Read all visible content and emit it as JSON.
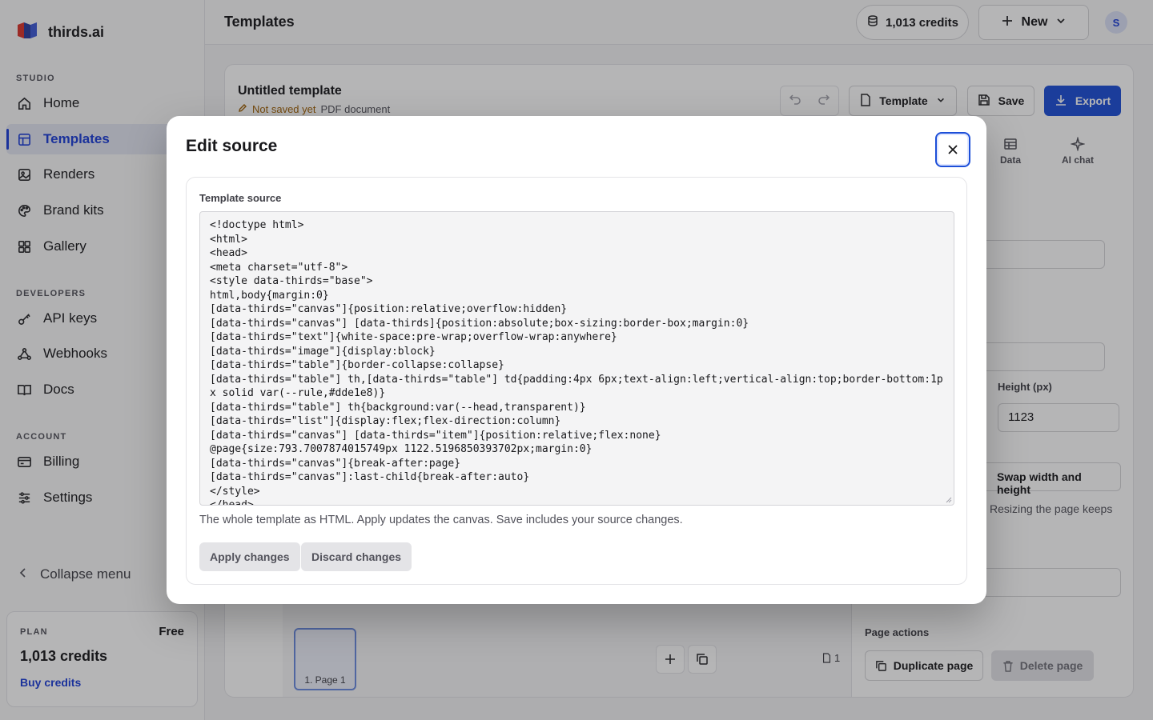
{
  "brand": {
    "name": "thirds.ai"
  },
  "sidebar": {
    "sections": {
      "studio": "STUDIO",
      "developers": "DEVELOPERS",
      "account": "ACCOUNT"
    },
    "items": [
      {
        "label": "Home",
        "icon": "home-icon"
      },
      {
        "label": "Templates",
        "icon": "templates-icon",
        "active": true
      },
      {
        "label": "Renders",
        "icon": "image-icon"
      },
      {
        "label": "Brand kits",
        "icon": "palette-icon"
      },
      {
        "label": "Gallery",
        "icon": "grid-icon"
      },
      {
        "label": "API keys",
        "icon": "key-icon"
      },
      {
        "label": "Webhooks",
        "icon": "webhook-icon"
      },
      {
        "label": "Docs",
        "icon": "book-icon"
      },
      {
        "label": "Billing",
        "icon": "card-icon"
      },
      {
        "label": "Settings",
        "icon": "sliders-icon"
      }
    ],
    "collapse_label": "Collapse menu",
    "plan": {
      "label": "PLAN",
      "tier": "Free",
      "credits": "1,013 credits",
      "buy_label": "Buy credits"
    }
  },
  "topbar": {
    "title": "Templates",
    "credits": "1,013 credits",
    "new_label": "New",
    "avatar_initial": "S"
  },
  "editor": {
    "doc_title": "Untitled template",
    "status": "Not saved yet",
    "doc_type": "PDF document",
    "template_label": "Template",
    "save_label": "Save",
    "export_label": "Export",
    "tabs": {
      "data": "Data",
      "ai_chat": "AI chat"
    },
    "height_label": "Height (px)",
    "height_value": "1123",
    "swap_label": "Swap width and height",
    "resize_hint": "Resizing the page keeps",
    "page_actions_label": "Page actions",
    "duplicate_page": "Duplicate page",
    "delete_page": "Delete page",
    "page_thumb_label": "1. Page 1",
    "page_count": "1"
  },
  "modal": {
    "title": "Edit source",
    "field_label": "Template source",
    "source": "<!doctype html>\n<html>\n<head>\n<meta charset=\"utf-8\">\n<style data-thirds=\"base\">\nhtml,body{margin:0}\n[data-thirds=\"canvas\"]{position:relative;overflow:hidden}\n[data-thirds=\"canvas\"] [data-thirds]{position:absolute;box-sizing:border-box;margin:0}\n[data-thirds=\"text\"]{white-space:pre-wrap;overflow-wrap:anywhere}\n[data-thirds=\"image\"]{display:block}\n[data-thirds=\"table\"]{border-collapse:collapse}\n[data-thirds=\"table\"] th,[data-thirds=\"table\"] td{padding:4px 6px;text-align:left;vertical-align:top;border-bottom:1px solid var(--rule,#dde1e8)}\n[data-thirds=\"table\"] th{background:var(--head,transparent)}\n[data-thirds=\"list\"]{display:flex;flex-direction:column}\n[data-thirds=\"canvas\"] [data-thirds=\"item\"]{position:relative;flex:none}\n@page{size:793.7007874015749px 1122.5196850393702px;margin:0}\n[data-thirds=\"canvas\"]{break-after:page}\n[data-thirds=\"canvas\"]:last-child{break-after:auto}\n</style>\n</head>",
    "help_text": "The whole template as HTML. Apply updates the canvas. Save includes your source changes.",
    "apply_label": "Apply changes",
    "discard_label": "Discard changes"
  },
  "colors": {
    "accent": "#1d4fd8",
    "overlay": "rgba(24,24,27,0.32)"
  }
}
